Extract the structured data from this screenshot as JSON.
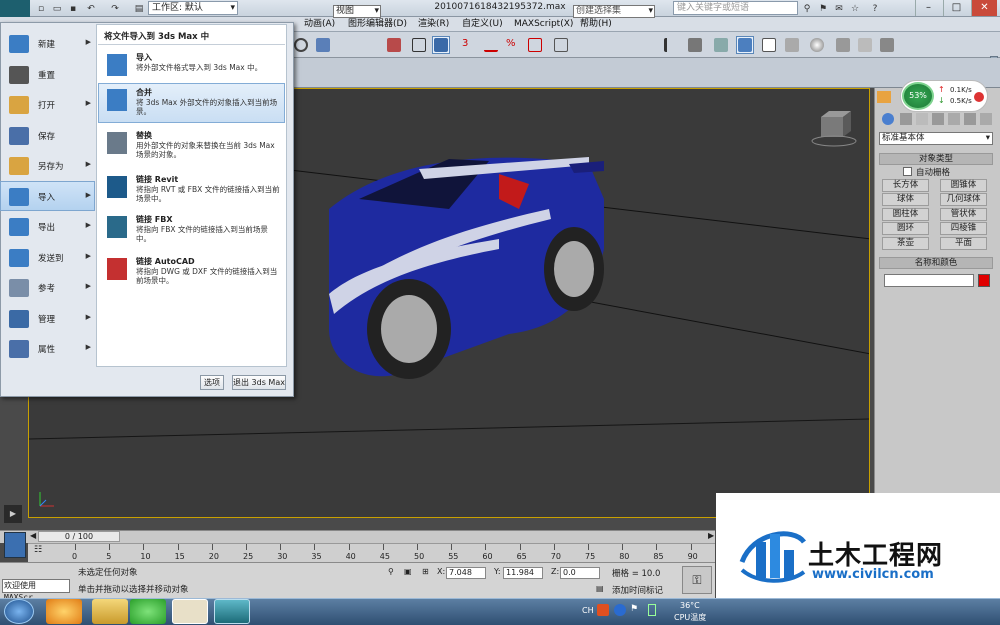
{
  "titlebar": {
    "workspace_label": "工作区: 默认",
    "file_title": "2010071618432195372.max",
    "search_placeholder": "键入关键字或短语"
  },
  "menubar": [
    "动画(A)",
    "图形编辑器(D)",
    "渲染(R)",
    "自定义(U)",
    "MAXScript(X)",
    "帮助(H)"
  ],
  "toolbar": {
    "view_dropdown": "视图",
    "selection_set_dropdown": "创建选择集"
  },
  "app_menu": {
    "items": [
      {
        "label": "新建",
        "icon": "new-icon",
        "arrow": true
      },
      {
        "label": "重置",
        "icon": "reset-icon",
        "arrow": false
      },
      {
        "label": "打开",
        "icon": "open-icon",
        "arrow": true
      },
      {
        "label": "保存",
        "icon": "save-icon",
        "arrow": false
      },
      {
        "label": "另存为",
        "icon": "save-as-icon",
        "arrow": true
      },
      {
        "label": "导入",
        "icon": "import-icon",
        "arrow": true
      },
      {
        "label": "导出",
        "icon": "export-icon",
        "arrow": true
      },
      {
        "label": "发送到",
        "icon": "send-to-icon",
        "arrow": true
      },
      {
        "label": "参考",
        "icon": "reference-icon",
        "arrow": true
      },
      {
        "label": "管理",
        "icon": "manage-icon",
        "arrow": true
      },
      {
        "label": "属性",
        "icon": "properties-icon",
        "arrow": true
      }
    ],
    "active_index": 5,
    "submenu_title": "将文件导入到 3ds Max 中",
    "submenu": [
      {
        "title": "导入",
        "desc": "将外部文件格式导入到 3ds Max 中。"
      },
      {
        "title": "合并",
        "desc": "将 3ds Max 外部文件的对象插入到当前场景。"
      },
      {
        "title": "替换",
        "desc": "用外部文件的对象来替换在当前 3ds Max 场景的对象。"
      },
      {
        "title": "链接 Revit",
        "desc": "将指向 RVT 或 FBX 文件的链接插入到当前场景中。"
      },
      {
        "title": "链接 FBX",
        "desc": "将指向 FBX 文件的链接插入到当前场景中。"
      },
      {
        "title": "链接 AutoCAD",
        "desc": "将指向 DWG 或 DXF 文件的链接插入到当前场景中。"
      }
    ],
    "highlight_index": 1,
    "options_button": "选项",
    "exit_button": "退出 3ds Max"
  },
  "net_widget": {
    "percent": "53%",
    "up": "0.1K/s",
    "down": "0.5K/s"
  },
  "cmd_panel": {
    "dropdown": "标准基本体",
    "object_type_header": "对象类型",
    "auto_grid": "自动栅格",
    "buttons": [
      "长方体",
      "圆锥体",
      "球体",
      "几何球体",
      "圆柱体",
      "管状体",
      "圆环",
      "四棱锥",
      "茶壶",
      "平面"
    ],
    "name_color_header": "名称和颜色",
    "swatch_color": "#e00000"
  },
  "timeline": {
    "frame_label": "0 / 100",
    "ticks": [
      "0",
      "5",
      "10",
      "15",
      "20",
      "25",
      "30",
      "35",
      "40",
      "45",
      "50",
      "55",
      "60",
      "65",
      "70",
      "75",
      "80",
      "85",
      "90"
    ]
  },
  "status": {
    "maxscript_label": "欢迎使用 MAXScr",
    "line1": "未选定任何对象",
    "line2": "单击并拖动以选择并移动对象",
    "x_label": "X:",
    "x_value": "7.048",
    "y_label": "Y:",
    "y_value": "11.984",
    "z_label": "Z:",
    "z_value": "0.0",
    "grid": "栅格 = 10.0",
    "add_time_tag": "添加时间标记"
  },
  "watermark": {
    "cn": "土木工程网",
    "url": "www.civilcn.com"
  },
  "taskbar": {
    "lang": "CH",
    "temp": "36°C",
    "temp_label": "CPU温度"
  }
}
